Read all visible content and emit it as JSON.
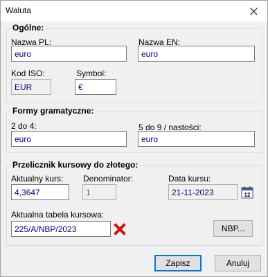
{
  "window": {
    "title": "Waluta"
  },
  "general": {
    "title": "Ogólne:",
    "name_pl_label": "Nazwa PL:",
    "name_pl_value": "euro",
    "name_en_label": "Nazwa EN:",
    "name_en_value": "euro",
    "iso_label": "Kod ISO:",
    "iso_value": "EUR",
    "symbol_label": "Symbol:",
    "symbol_value": "€"
  },
  "grammar": {
    "title": "Formy gramatyczne:",
    "form_2_4_label": "2 do 4:",
    "form_2_4_value": "euro",
    "form_5_9_label": "5 do 9 / nastości:",
    "form_5_9_value": "euro"
  },
  "rate": {
    "title": "Przelicznik kursowy do złotego:",
    "current_rate_label": "Aktualny kurs:",
    "current_rate_value": "4,3647",
    "denominator_label": "Denominator:",
    "denominator_value": "1",
    "date_label": "Data kursu:",
    "date_value": "21-11-2023",
    "calendar_day": "12",
    "table_label": "Aktualna tabela kursowa:",
    "table_value": "225/A/NBP/2023",
    "nbp_button": "NBP..."
  },
  "footer": {
    "save_button": "Zapisz",
    "cancel_button": "Anuluj"
  }
}
